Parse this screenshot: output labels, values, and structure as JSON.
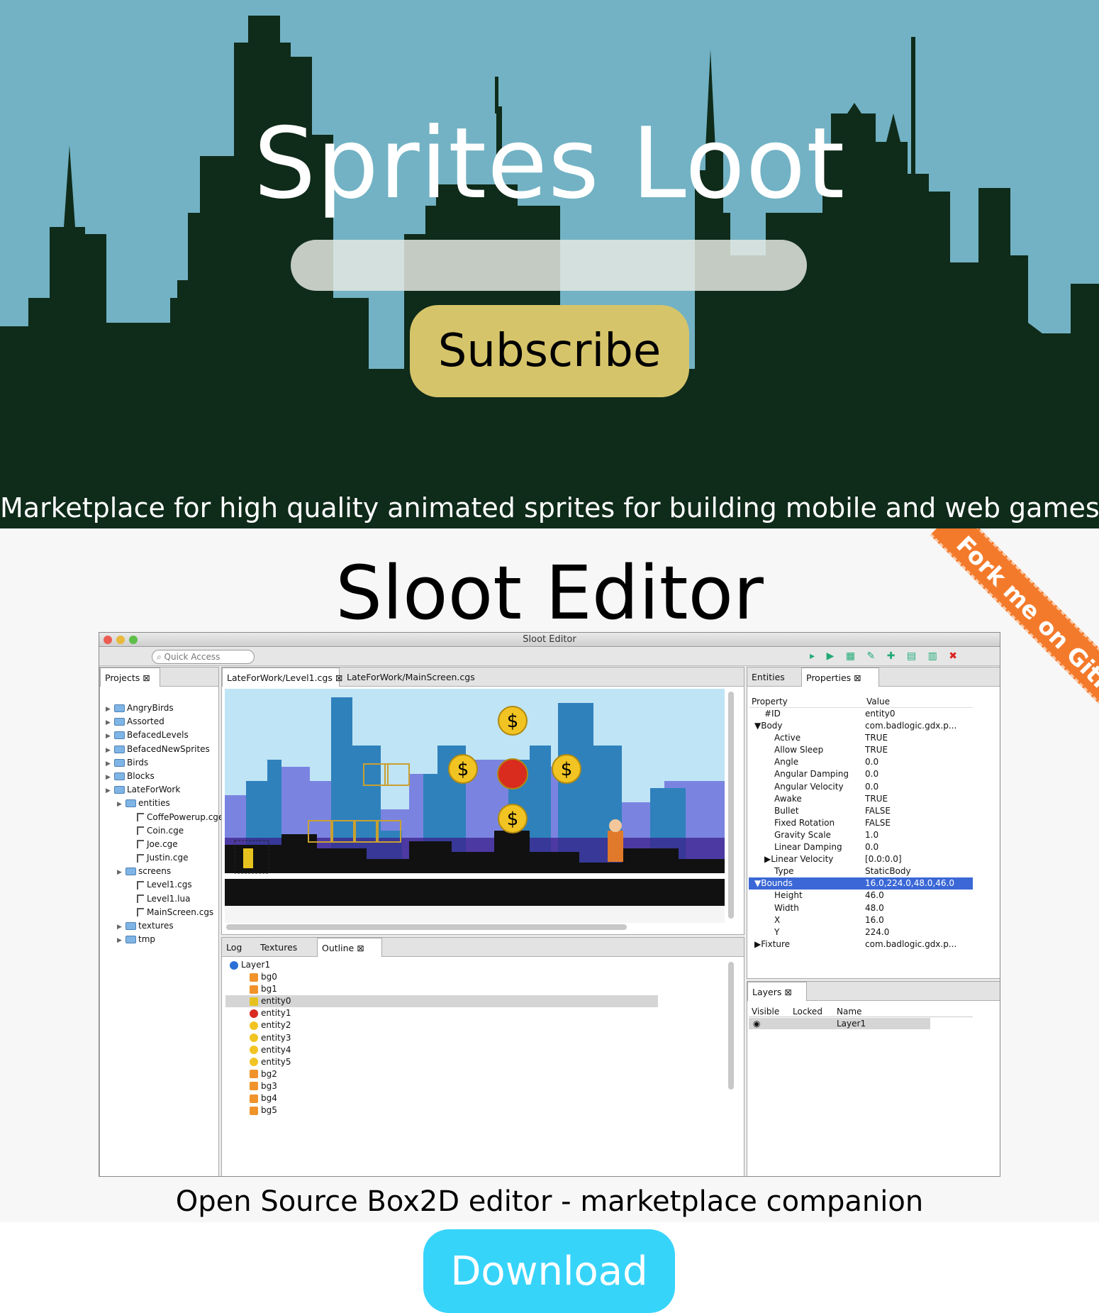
{
  "hero": {
    "title": "Sprites Loot",
    "email_placeholder": "",
    "subscribe_label": "Subscribe",
    "tagline": "Marketplace for high quality animated sprites for building mobile and web games.",
    "colors": {
      "sky": "#72b2c4",
      "skyline": "#0f2b1a",
      "button": "#d6c46a"
    }
  },
  "editor": {
    "title": "Sloot Editor",
    "ribbon": "Fork me on GitHub",
    "subtitle": "Open Source Box2D editor - marketplace companion",
    "ribbon_color": "#f47a2b"
  },
  "screenshot": {
    "window_title": "Sloot Editor",
    "quick_access": "Quick Access",
    "projects_tab": "Projects",
    "editor_tabs": [
      "LateForWork/Level1.cgs",
      "LateForWork/MainScreen.cgs"
    ],
    "right_tabs": [
      "Entities",
      "Properties"
    ],
    "bottom_tabs": [
      "Log",
      "Textures",
      "Outline"
    ],
    "layers_tab": "Layers",
    "project_tree": [
      {
        "label": "AngryBirds",
        "level": 0,
        "type": "folder"
      },
      {
        "label": "Assorted",
        "level": 0,
        "type": "folder"
      },
      {
        "label": "BefacedLevels",
        "level": 0,
        "type": "folder"
      },
      {
        "label": "BefacedNewSprites",
        "level": 0,
        "type": "folder"
      },
      {
        "label": "Birds",
        "level": 0,
        "type": "folder"
      },
      {
        "label": "Blocks",
        "level": 0,
        "type": "folder"
      },
      {
        "label": "LateForWork",
        "level": 0,
        "type": "folder"
      },
      {
        "label": "entities",
        "level": 1,
        "type": "folder"
      },
      {
        "label": "CoffePowerup.cge",
        "level": 2,
        "type": "file"
      },
      {
        "label": "Coin.cge",
        "level": 2,
        "type": "file"
      },
      {
        "label": "Joe.cge",
        "level": 2,
        "type": "file"
      },
      {
        "label": "Justin.cge",
        "level": 2,
        "type": "file"
      },
      {
        "label": "screens",
        "level": 1,
        "type": "folder"
      },
      {
        "label": "Level1.cgs",
        "level": 2,
        "type": "file"
      },
      {
        "label": "Level1.lua",
        "level": 2,
        "type": "file"
      },
      {
        "label": "MainScreen.cgs",
        "level": 2,
        "type": "file"
      },
      {
        "label": "textures",
        "level": 1,
        "type": "folder"
      },
      {
        "label": "tmp",
        "level": 1,
        "type": "folder"
      }
    ],
    "properties": {
      "header_property": "Property",
      "header_value": "Value",
      "rows": [
        {
          "key": "#ID",
          "value": "entity0",
          "indent": 1,
          "selected": false
        },
        {
          "key": "▼Body",
          "value": "com.badlogic.gdx.p...",
          "indent": 0,
          "selected": false
        },
        {
          "key": "Active",
          "value": "TRUE",
          "indent": 2,
          "selected": false
        },
        {
          "key": "Allow Sleep",
          "value": "TRUE",
          "indent": 2,
          "selected": false
        },
        {
          "key": "Angle",
          "value": "0.0",
          "indent": 2,
          "selected": false
        },
        {
          "key": "Angular Damping",
          "value": "0.0",
          "indent": 2,
          "selected": false
        },
        {
          "key": "Angular Velocity",
          "value": "0.0",
          "indent": 2,
          "selected": false
        },
        {
          "key": "Awake",
          "value": "TRUE",
          "indent": 2,
          "selected": false
        },
        {
          "key": "Bullet",
          "value": "FALSE",
          "indent": 2,
          "selected": false
        },
        {
          "key": "Fixed Rotation",
          "value": "FALSE",
          "indent": 2,
          "selected": false
        },
        {
          "key": "Gravity Scale",
          "value": "1.0",
          "indent": 2,
          "selected": false
        },
        {
          "key": "Linear Damping",
          "value": "0.0",
          "indent": 2,
          "selected": false
        },
        {
          "key": "▶Linear Velocity",
          "value": "[0.0:0.0]",
          "indent": 1,
          "selected": false
        },
        {
          "key": "Type",
          "value": "StaticBody",
          "indent": 2,
          "selected": false
        },
        {
          "key": "▼Bounds",
          "value": "16.0,224.0,48.0,46.0",
          "indent": 0,
          "selected": true
        },
        {
          "key": "Height",
          "value": "46.0",
          "indent": 2,
          "selected": false
        },
        {
          "key": "Width",
          "value": "48.0",
          "indent": 2,
          "selected": false
        },
        {
          "key": "X",
          "value": "16.0",
          "indent": 2,
          "selected": false
        },
        {
          "key": "Y",
          "value": "224.0",
          "indent": 2,
          "selected": false
        },
        {
          "key": "▶Fixture",
          "value": "com.badlogic.gdx.p...",
          "indent": 0,
          "selected": false
        }
      ]
    },
    "outline": [
      {
        "label": "Layer1",
        "type": "layer",
        "selected": false
      },
      {
        "label": "bg0",
        "type": "bg",
        "selected": false
      },
      {
        "label": "bg1",
        "type": "bg",
        "selected": false
      },
      {
        "label": "entity0",
        "type": "runner",
        "selected": true
      },
      {
        "label": "entity1",
        "type": "coffee",
        "selected": false
      },
      {
        "label": "entity2",
        "type": "coin",
        "selected": false
      },
      {
        "label": "entity3",
        "type": "coin",
        "selected": false
      },
      {
        "label": "entity4",
        "type": "coin",
        "selected": false
      },
      {
        "label": "entity5",
        "type": "coin",
        "selected": false
      },
      {
        "label": "bg2",
        "type": "bg",
        "selected": false
      },
      {
        "label": "bg3",
        "type": "bg",
        "selected": false
      },
      {
        "label": "bg4",
        "type": "bg",
        "selected": false
      },
      {
        "label": "bg5",
        "type": "bg",
        "selected": false
      }
    ],
    "layers": {
      "headers": [
        "Visible",
        "Locked",
        "Name"
      ],
      "rows": [
        {
          "name": "Layer1"
        }
      ]
    }
  },
  "download": {
    "label": "Download",
    "color": "#37d4fa"
  }
}
